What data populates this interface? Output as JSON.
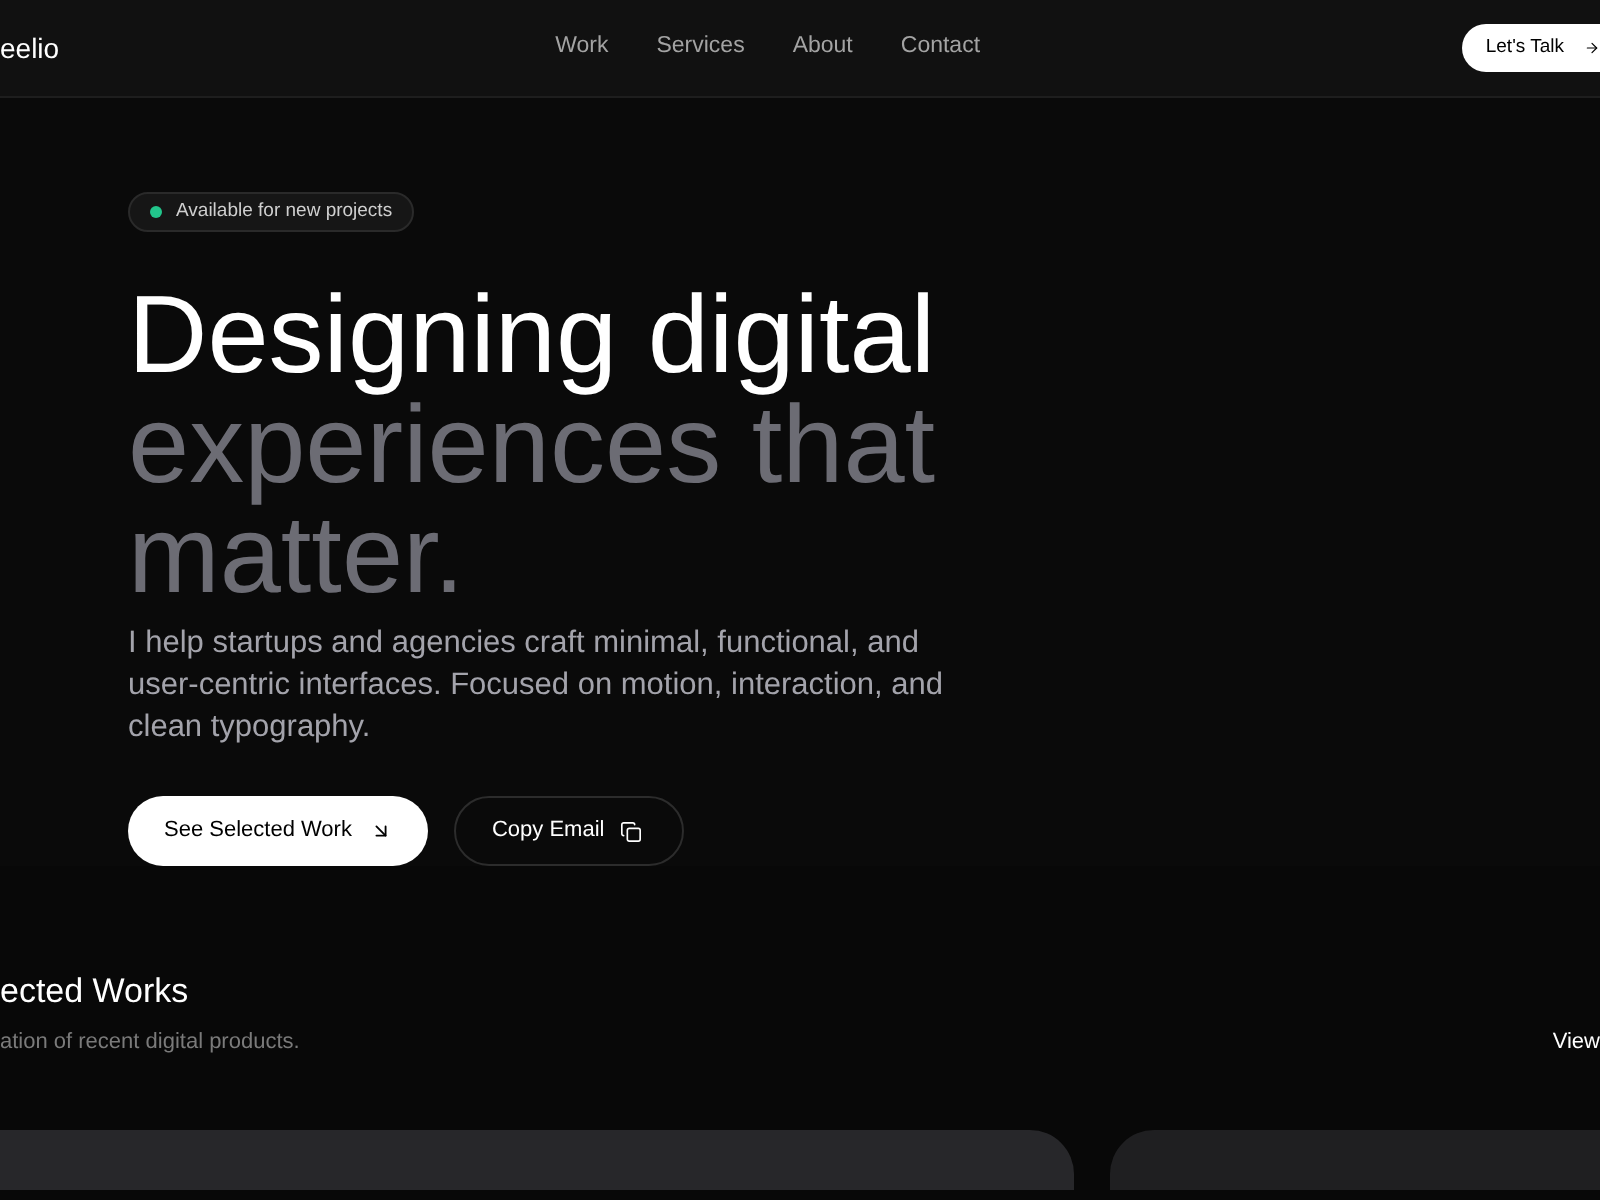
{
  "header": {
    "logo": "eelio",
    "nav": [
      "Work",
      "Services",
      "About",
      "Contact"
    ],
    "cta": "Let's Talk"
  },
  "hero": {
    "badge": "Available for new projects",
    "heading": {
      "lead": "Designing digital",
      "muted": "experiences that matter."
    },
    "description": "I help startups and agencies craft minimal, functional, and user-centric interfaces. Focused on motion, interaction, and clean typography.",
    "buttons": [
      {
        "label": "See Selected Work",
        "kind": "primary"
      },
      {
        "label": "Copy Email",
        "kind": "secondary"
      }
    ]
  },
  "works": {
    "title": "ected Works",
    "subtitle": "ation of recent digital products.",
    "link": "View"
  }
}
